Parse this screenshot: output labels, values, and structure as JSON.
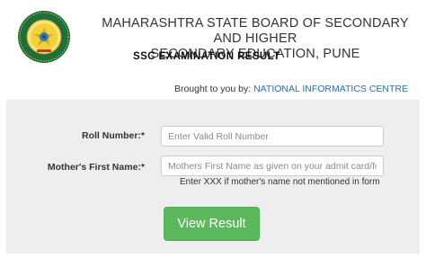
{
  "header": {
    "board_name_line1": "MAHARASHTRA STATE BOARD OF SECONDARY AND HIGHER",
    "board_name_line2": "SECONDARY EDUCATION, PUNE",
    "exam_title": "SSC EXAMINATION RESULT",
    "logo_icon": "board-seal-icon"
  },
  "credit": {
    "prefix": "Brought to you by:",
    "organization": "NATIONAL INFORMATICS CENTRE"
  },
  "form": {
    "roll_label": "Roll Number:*",
    "roll_placeholder": "Enter Valid Roll Number",
    "roll_value": "",
    "mother_label": "Mother's First Name:*",
    "mother_placeholder": "Mothers First Name as given on your admit card/form",
    "mother_value": "",
    "mother_hint": "Enter XXX if mother's name not mentioned in form",
    "submit_label": "View Result"
  },
  "colors": {
    "button": "#5cb85c",
    "link": "#2a6fb0",
    "panel": "#eeeeee",
    "seal_ring": "#1f6f3a",
    "seal_inner": "#f2d23c"
  }
}
